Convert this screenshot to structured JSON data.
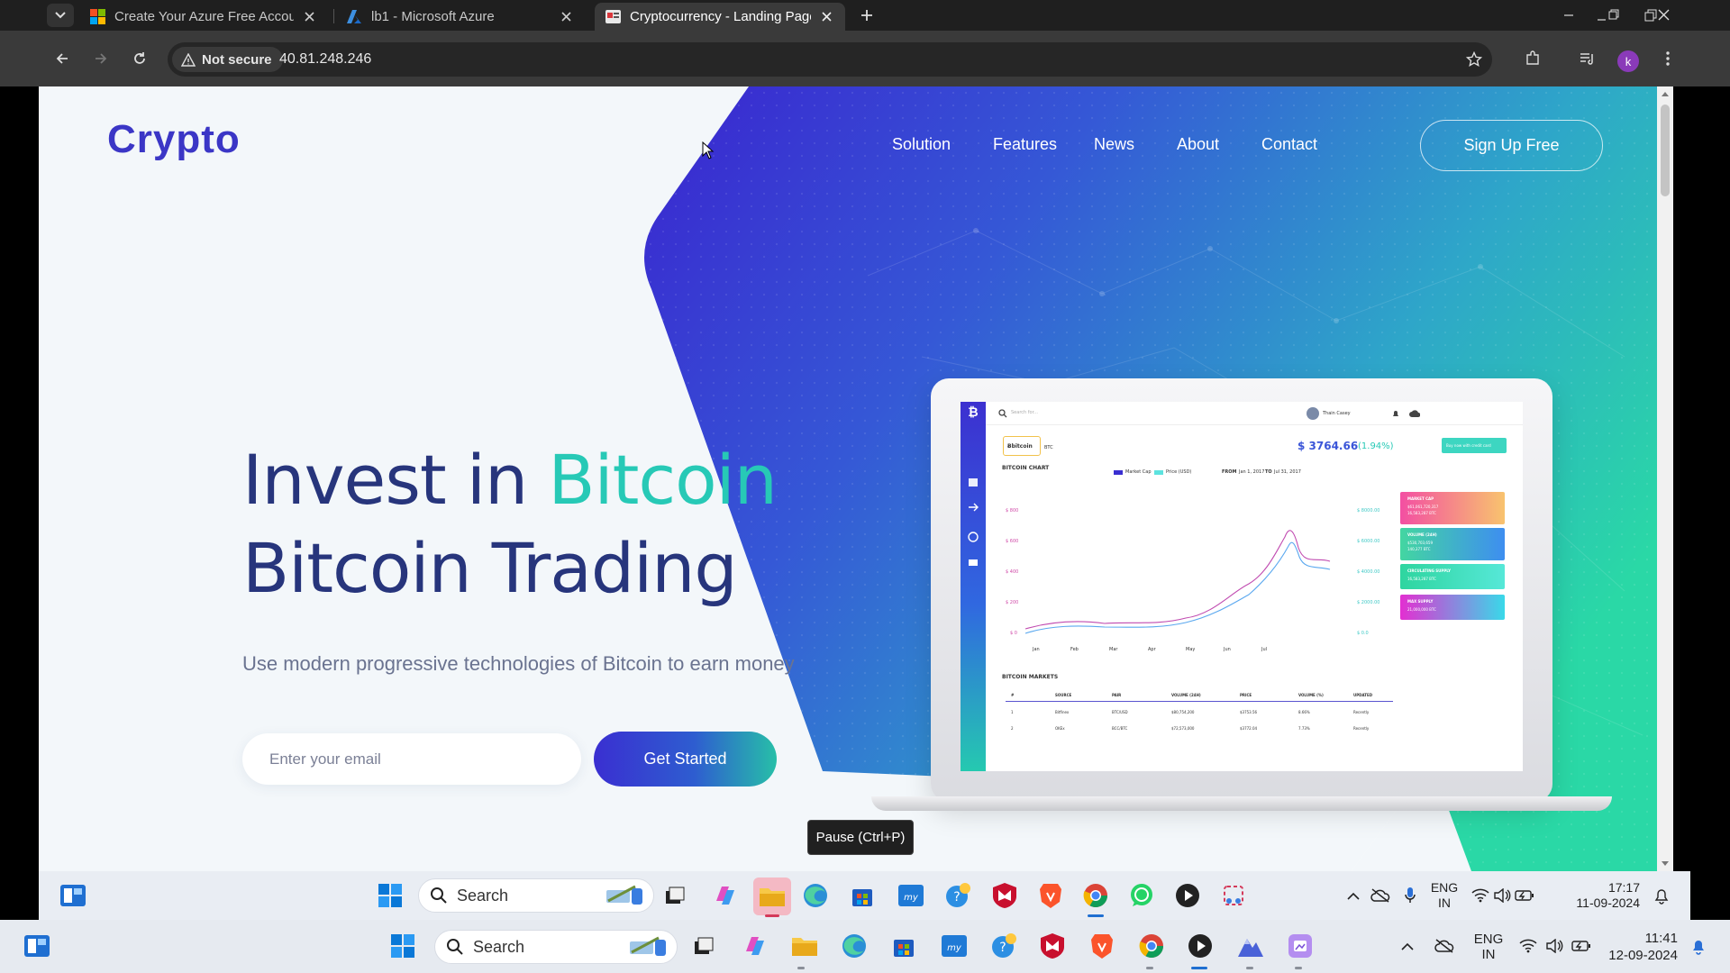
{
  "browser": {
    "tabs": [
      {
        "title": "Create Your Azure Free Account",
        "active": false
      },
      {
        "title": "lb1 - Microsoft Azure",
        "active": false
      },
      {
        "title": "Cryptocurrency - Landing Page",
        "active": true
      }
    ],
    "security_label": "Not secure",
    "url": "40.81.248.246",
    "profile_initial": "k"
  },
  "page": {
    "logo": "Crypto",
    "nav": [
      "Solution",
      "Features",
      "News",
      "About",
      "Contact"
    ],
    "signup_label": "Sign Up Free",
    "headline_line1_prefix": "Invest in",
    "headline_line1_accent": "Bitcoin",
    "headline_line2": "Bitcoin Trading",
    "subline": "Use modern progressive technologies of Bitcoin to earn money",
    "email_placeholder": "Enter your email",
    "cta_label": "Get Started",
    "colors": {
      "brand": "#3b36c6",
      "accent": "#27c9b6",
      "heading": "#27357c"
    }
  },
  "dashboard": {
    "search_placeholder": "Search for...",
    "user_name": "Thain Casey",
    "coin_logo": "Ƀbitcoin",
    "coin_ticker": "BTC",
    "price": "$ 3764.66",
    "price_change": "(1.94%)",
    "buy_label": "Buy now with credit card",
    "chart_title": "BITCOIN CHART",
    "legend": [
      "Market Cap",
      "Price (USD)"
    ],
    "range_from_label": "FROM",
    "range_from": "Jan 1, 2017",
    "range_to_label": "TO",
    "range_to": "Jul 31, 2017",
    "y_left": [
      "$ 800",
      "$ 600",
      "$ 400",
      "$ 200",
      "$ 0"
    ],
    "y_right": [
      "$ 8000.00",
      "$ 6000.00",
      "$ 4000.00",
      "$ 2000.00",
      "$ 0.0"
    ],
    "x_months": [
      "Jan",
      "Feb",
      "Mar",
      "Apr",
      "May",
      "Jun",
      "Jul"
    ],
    "stats": [
      {
        "title": "MARKET CAP",
        "line1": "$61,061,720,317",
        "line2": "16,583,287 BTC",
        "color_from": "#f34fa2",
        "color_to": "#f8c36e"
      },
      {
        "title": "VOLUME (24H)",
        "line1": "$530,703,659",
        "line2": "140,377 BTC",
        "color_from": "#43d6a1",
        "color_to": "#3e8ef0"
      },
      {
        "title": "CIRCULATING SUPPLY",
        "line1": "16,583,287 BTC",
        "line2": "",
        "color_from": "#2ed59f",
        "color_to": "#56e8d8"
      },
      {
        "title": "MAX SUPPLY",
        "line1": "21,000,000 BTC",
        "line2": "",
        "color_from": "#e32fd1",
        "color_to": "#39d9e9"
      }
    ],
    "markets_title": "BITCOIN MARKETS",
    "market_columns": [
      "#",
      "SOURCE",
      "PAIR",
      "VOLUME (24H)",
      "PRICE",
      "VOLUME (%)",
      "UPDATED"
    ],
    "market_rows": [
      [
        "1",
        "Bitfinex",
        "BTC/USD",
        "$80,754,200",
        "$3753.56",
        "8.66%",
        "Recently"
      ],
      [
        "2",
        "OKEx",
        "BCC/BTC",
        "$72,573,000",
        "$3772.04",
        "7.73%",
        "Recently"
      ]
    ]
  },
  "tooltip": "Pause (Ctrl+P)",
  "taskbar_inner": {
    "search_label": "Search",
    "lang_line1": "ENG",
    "lang_line2": "IN",
    "time": "17:17",
    "date": "11-09-2024"
  },
  "taskbar_outer": {
    "search_label": "Search",
    "lang_line1": "ENG",
    "lang_line2": "IN",
    "time": "11:41",
    "date": "12-09-2024"
  }
}
